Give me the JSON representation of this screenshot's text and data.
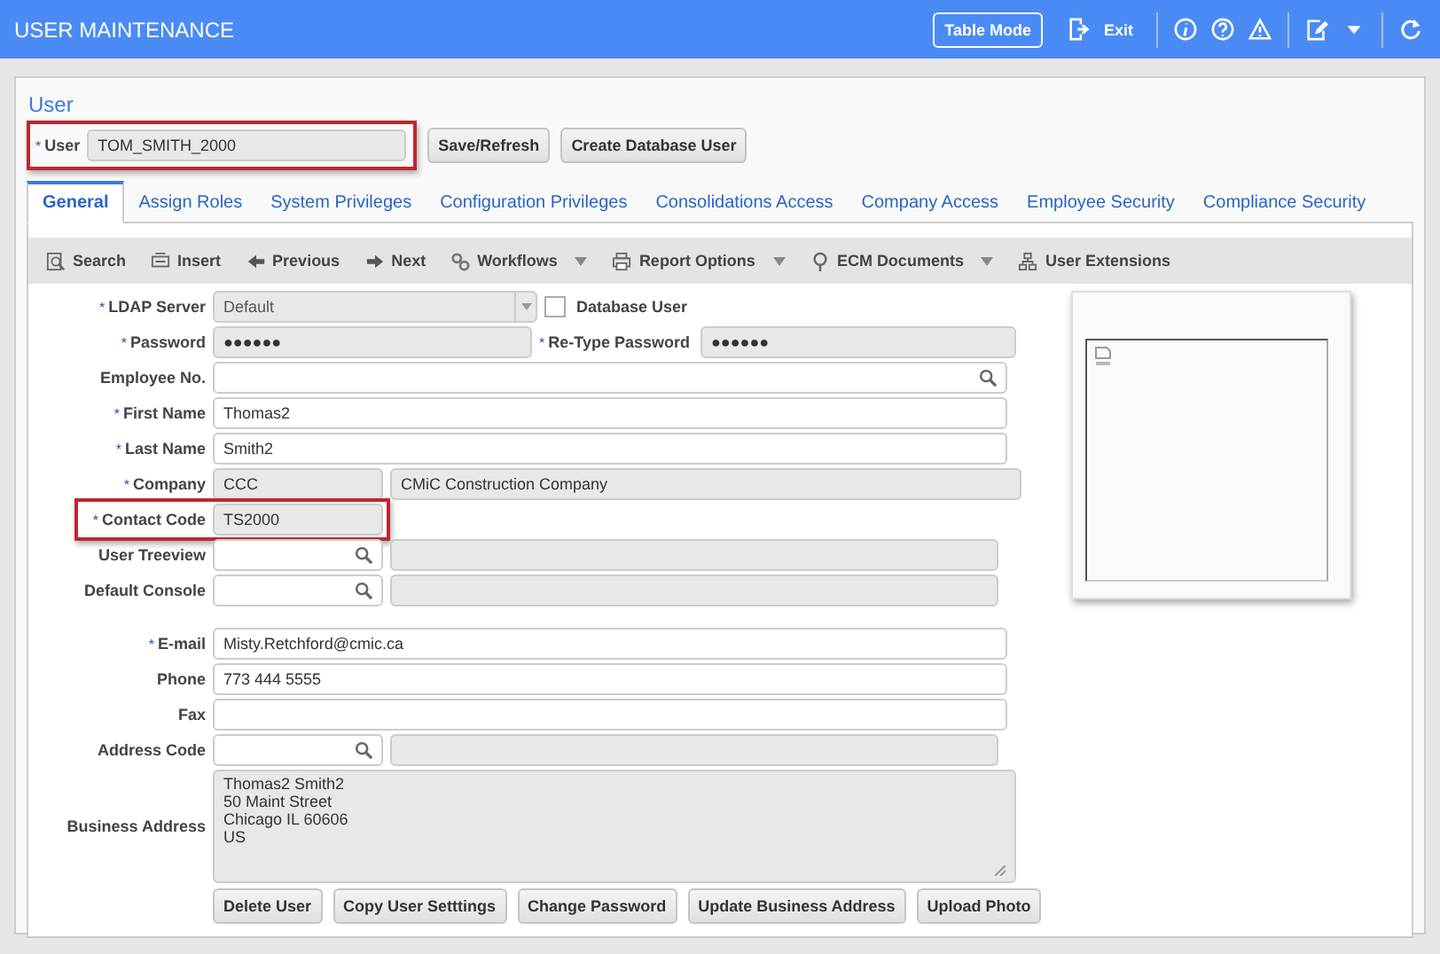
{
  "header": {
    "title": "USER MAINTENANCE",
    "table_mode": "Table Mode",
    "exit": "Exit"
  },
  "user_section": {
    "title": "User",
    "field": {
      "marker": "*",
      "label": "User",
      "highlighted": true,
      "value": "TOM_SMITH_2000"
    },
    "buttons": [
      "Save/Refresh",
      "Create Database User"
    ]
  },
  "tabs": [
    {
      "label": "General",
      "selected": true
    },
    {
      "label": "Assign Roles",
      "selected": false
    },
    {
      "label": "System Privileges",
      "selected": false
    },
    {
      "label": "Configuration Privileges",
      "selected": false
    },
    {
      "label": "Consolidations Access",
      "selected": false
    },
    {
      "label": "Company Access",
      "selected": false
    },
    {
      "label": "Employee Security",
      "selected": false
    },
    {
      "label": "Compliance Security",
      "selected": false
    }
  ],
  "toolbar": [
    {
      "kind": "search",
      "label": "Search",
      "dropdown": false
    },
    {
      "kind": "insert",
      "label": "Insert",
      "dropdown": false
    },
    {
      "kind": "previous",
      "label": "Previous",
      "dropdown": false
    },
    {
      "kind": "next",
      "label": "Next",
      "dropdown": false
    },
    {
      "kind": "workflows",
      "label": "Workflows",
      "dropdown": true
    },
    {
      "kind": "report",
      "label": "Report Options",
      "dropdown": true
    },
    {
      "kind": "ecm",
      "label": "ECM Documents",
      "dropdown": true
    },
    {
      "kind": "extensions",
      "label": "User Extensions",
      "dropdown": false
    }
  ],
  "form_groups": [
    [
      {
        "kind": "select_check",
        "marker": "*",
        "label": "LDAP Server",
        "highlighted": false,
        "fields": [
          {
            "kind": "select",
            "value": "Default"
          }
        ],
        "checkbox": {
          "label": "Database User",
          "checked": false
        }
      },
      {
        "kind": "pair",
        "marker": "*",
        "label": "Password",
        "highlighted": false,
        "fields": [
          {
            "kind": "password",
            "value": "●●●●●●"
          }
        ],
        "second": {
          "marker": "*",
          "label": "Re-Type Password",
          "field": {
            "kind": "password",
            "value": "●●●●●●"
          }
        }
      },
      {
        "kind": "full",
        "label": "Employee No.",
        "highlighted": false,
        "fields": [
          {
            "kind": "search"
          }
        ]
      },
      {
        "kind": "full",
        "marker": "*",
        "label": "First Name",
        "highlighted": false,
        "fields": [
          {
            "kind": "text",
            "value": "Thomas2"
          }
        ]
      },
      {
        "kind": "full",
        "marker": "*",
        "label": "Last Name",
        "highlighted": false,
        "fields": [
          {
            "kind": "text",
            "value": "Smith2"
          }
        ]
      },
      {
        "kind": "short_long",
        "marker": "*",
        "label": "Company",
        "highlighted": false,
        "fields": [
          {
            "kind": "readonly",
            "value": "CCC"
          },
          {
            "kind": "readonly",
            "value": "CMiC Construction Company"
          }
        ]
      },
      {
        "kind": "short",
        "marker": "*",
        "label": "Contact Code",
        "highlighted": true,
        "fields": [
          {
            "kind": "readonly",
            "value": "TS2000"
          }
        ]
      },
      {
        "kind": "short_long",
        "label": "User Treeview",
        "highlighted": false,
        "fields": [
          {
            "kind": "lookup"
          },
          {
            "kind": "readonly"
          }
        ]
      },
      {
        "kind": "short_long",
        "label": "Default Console",
        "highlighted": false,
        "fields": [
          {
            "kind": "lookup"
          },
          {
            "kind": "readonly"
          }
        ]
      }
    ],
    [
      {
        "kind": "full",
        "marker": "*",
        "label": "E-mail",
        "highlighted": false,
        "fields": [
          {
            "kind": "text",
            "value": "Misty.Retchford@cmic.ca"
          }
        ]
      },
      {
        "kind": "full",
        "label": "Phone",
        "highlighted": false,
        "fields": [
          {
            "kind": "text",
            "value": "773 444 5555"
          }
        ]
      },
      {
        "kind": "full",
        "label": "Fax",
        "highlighted": false,
        "fields": [
          {
            "kind": "text"
          }
        ]
      },
      {
        "kind": "short_long",
        "label": "Address Code",
        "highlighted": false,
        "fields": [
          {
            "kind": "lookup"
          },
          {
            "kind": "readonly"
          }
        ]
      },
      {
        "kind": "textarea",
        "label": "Business Address",
        "highlighted": false,
        "fields": [
          {
            "kind": "textarea",
            "value": "Thomas2 Smith2\n50 Maint Street\nChicago IL 60606\nUS"
          }
        ]
      }
    ]
  ],
  "action_buttons": [
    "Delete User",
    "Copy User Setttings",
    "Change Password",
    "Update Business Address",
    "Upload Photo"
  ]
}
